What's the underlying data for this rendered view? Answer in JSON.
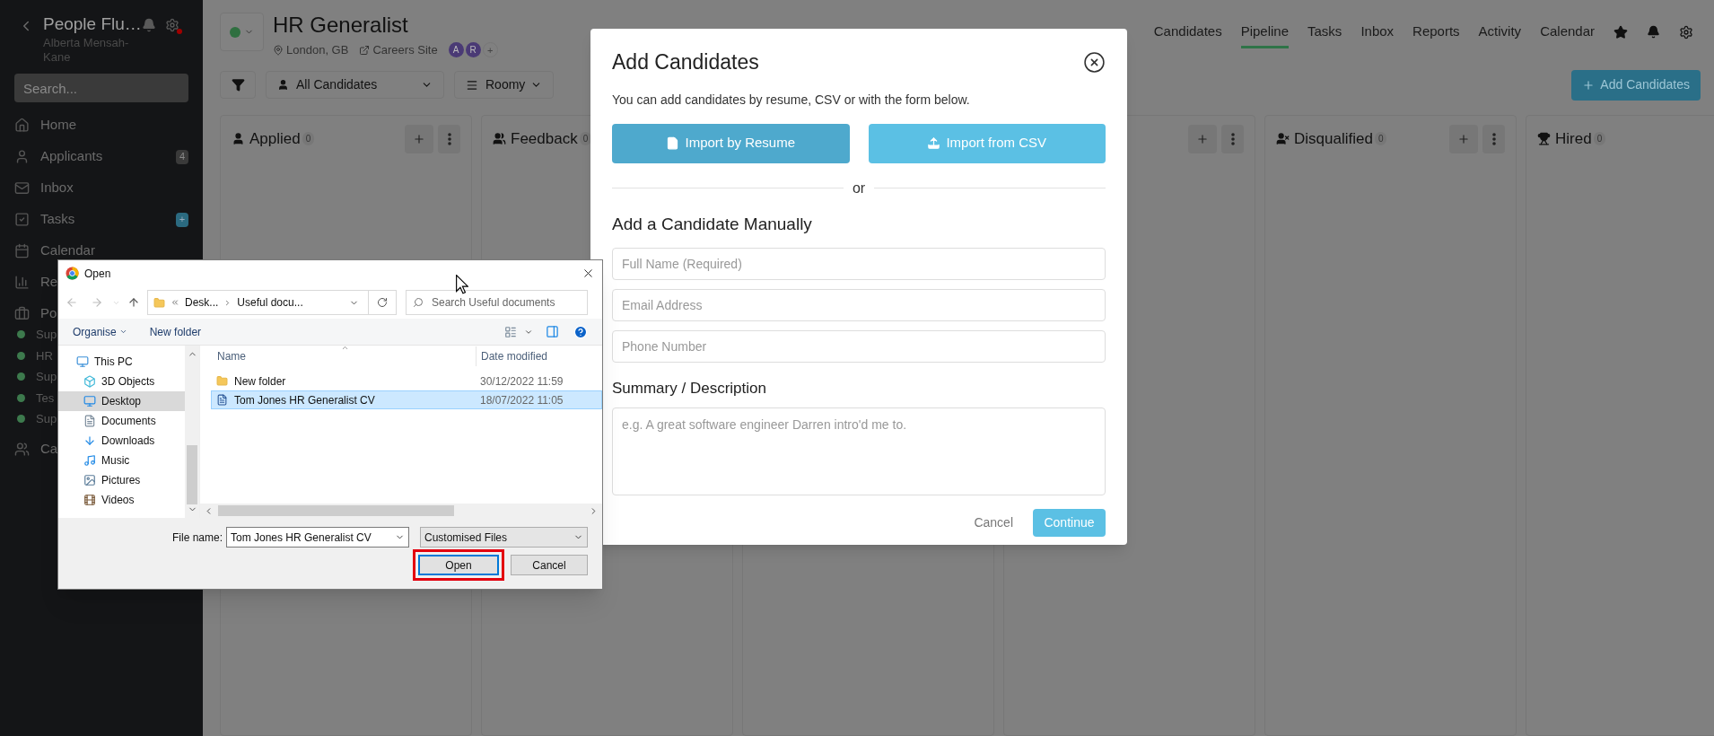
{
  "sidebar": {
    "title": "People Flu…",
    "user": "Alberta Mensah-Kane",
    "search": {
      "placeholder": "Search..."
    },
    "items": [
      {
        "label": "Home"
      },
      {
        "label": "Applicants",
        "badge": "4"
      },
      {
        "label": "Inbox"
      },
      {
        "label": "Tasks",
        "badge": "+"
      },
      {
        "label": "Calendar"
      },
      {
        "label": "Re"
      },
      {
        "label": "Po",
        "children": [
          {
            "label": "Sup"
          },
          {
            "label": "HR"
          },
          {
            "label": "Sup"
          },
          {
            "label": "Tes"
          },
          {
            "label": "Sup"
          }
        ]
      },
      {
        "label": "Ca"
      }
    ]
  },
  "job": {
    "title": "HR Generalist",
    "location": "London, GB",
    "careers_link": "Careers Site",
    "avatars": [
      "A",
      "R"
    ],
    "add_member": "+"
  },
  "nav": [
    {
      "label": "Candidates",
      "selected": false
    },
    {
      "label": "Pipeline",
      "selected": true
    },
    {
      "label": "Tasks",
      "selected": false
    },
    {
      "label": "Inbox",
      "selected": false
    },
    {
      "label": "Reports",
      "selected": false
    },
    {
      "label": "Activity",
      "selected": false
    },
    {
      "label": "Calendar",
      "selected": false
    }
  ],
  "toolbar": {
    "candidate_filter": "All Candidates",
    "view": "Roomy",
    "add_button": "Add Candidates"
  },
  "columns": [
    {
      "title": "Applied",
      "count": "0",
      "actions": true
    },
    {
      "title": "Feedback",
      "count": "0"
    },
    {},
    {
      "actions": true
    },
    {
      "title": "Disqualified",
      "count": "0",
      "actions": true
    },
    {
      "title": "Hired",
      "count": "0"
    }
  ],
  "modal": {
    "title": "Add Candidates",
    "description": "You can add candidates by resume, CSV or with the form below.",
    "import_buttons": [
      {
        "label": "Import by Resume",
        "pressed": true
      },
      {
        "label": "Import from CSV",
        "pressed": false
      }
    ],
    "divider": "or",
    "manual_heading": "Add a Candidate Manually",
    "fields": [
      {
        "placeholder": "Full Name (Required)"
      },
      {
        "placeholder": "Email Address"
      },
      {
        "placeholder": "Phone Number"
      }
    ],
    "summary_label": "Summary / Description",
    "summary": {
      "placeholder": "e.g. A great software engineer Darren intro'd me to."
    },
    "cancel": "Cancel",
    "continue": "Continue"
  },
  "open_dialog": {
    "title": "Open",
    "path": [
      "Desk...",
      "Useful docu..."
    ],
    "search": {
      "placeholder": "Search Useful documents"
    },
    "commands": {
      "organise": "Organise",
      "new_folder": "New folder"
    },
    "tree": [
      {
        "label": "This PC",
        "selected": false,
        "children": [
          {
            "label": "3D Objects",
            "selected": false
          },
          {
            "label": "Desktop",
            "selected": true
          },
          {
            "label": "Documents",
            "selected": false
          },
          {
            "label": "Downloads",
            "selected": false
          },
          {
            "label": "Music",
            "selected": false
          },
          {
            "label": "Pictures",
            "selected": false
          },
          {
            "label": "Videos",
            "selected": false
          }
        ]
      }
    ],
    "columns": [
      "Name",
      "Date modified"
    ],
    "files": [
      {
        "kind": "folder",
        "name": "New folder",
        "modified": "30/12/2022 11:59",
        "selected": false
      },
      {
        "kind": "document",
        "name": "Tom Jones HR Generalist CV",
        "modified": "18/07/2022 11:05",
        "selected": true
      }
    ],
    "file_name_label": "File name:",
    "file_name": "Tom Jones HR Generalist CV",
    "file_type": "Customised Files",
    "open_button": {
      "label": "Open",
      "highlighted": true
    },
    "cancel_button": "Cancel"
  }
}
